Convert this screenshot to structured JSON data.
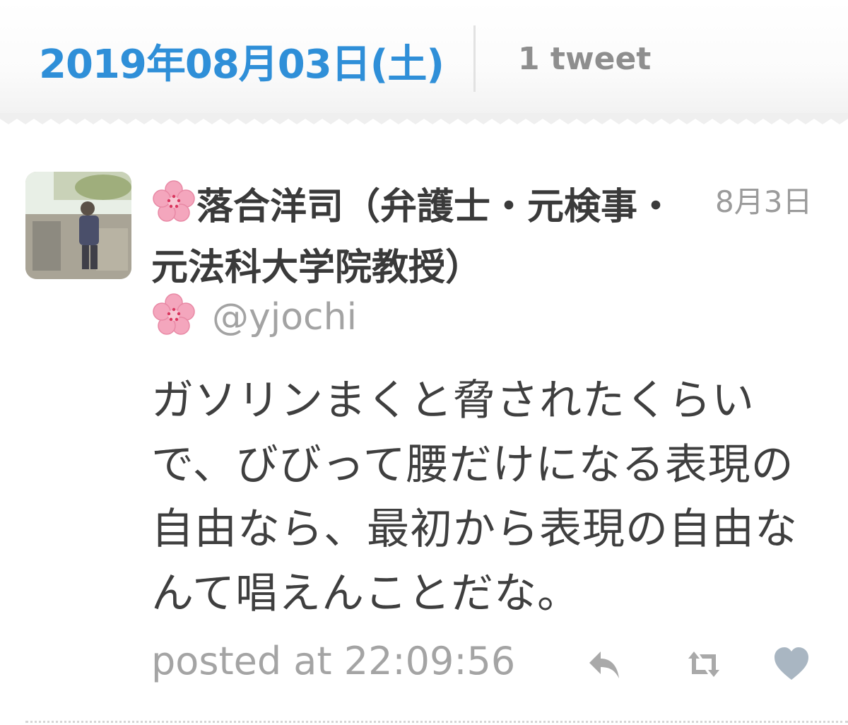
{
  "header": {
    "date_label": "2019年08月03日(土)",
    "tweet_count": "1 tweet"
  },
  "tweet": {
    "avatar_icon": "user-photo-avatar",
    "name": "落合洋司（弁護士・元検事・元法科大学院教授）",
    "name_prefix_icon": "cherry-blossom-icon",
    "handle_prefix_icon": "cherry-blossom-icon",
    "handle": "@yjochi",
    "date": "8月3日",
    "text": "ガソリンまくと脅されたくらいで、びびって腰だけになる表現の自由なら、最初から表現の自由なんて唱えんことだな。",
    "posted_at": "posted at 22:09:56",
    "actions": {
      "reply_icon": "reply-icon",
      "retweet_icon": "retweet-icon",
      "like_icon": "heart-icon"
    }
  },
  "colors": {
    "date_blue": "#2f8fd8",
    "text_dark": "#3f3f3f",
    "text_gray": "#a3a3a3",
    "blossom_pink": "#f4a6bd",
    "blossom_center": "#d9365e"
  }
}
